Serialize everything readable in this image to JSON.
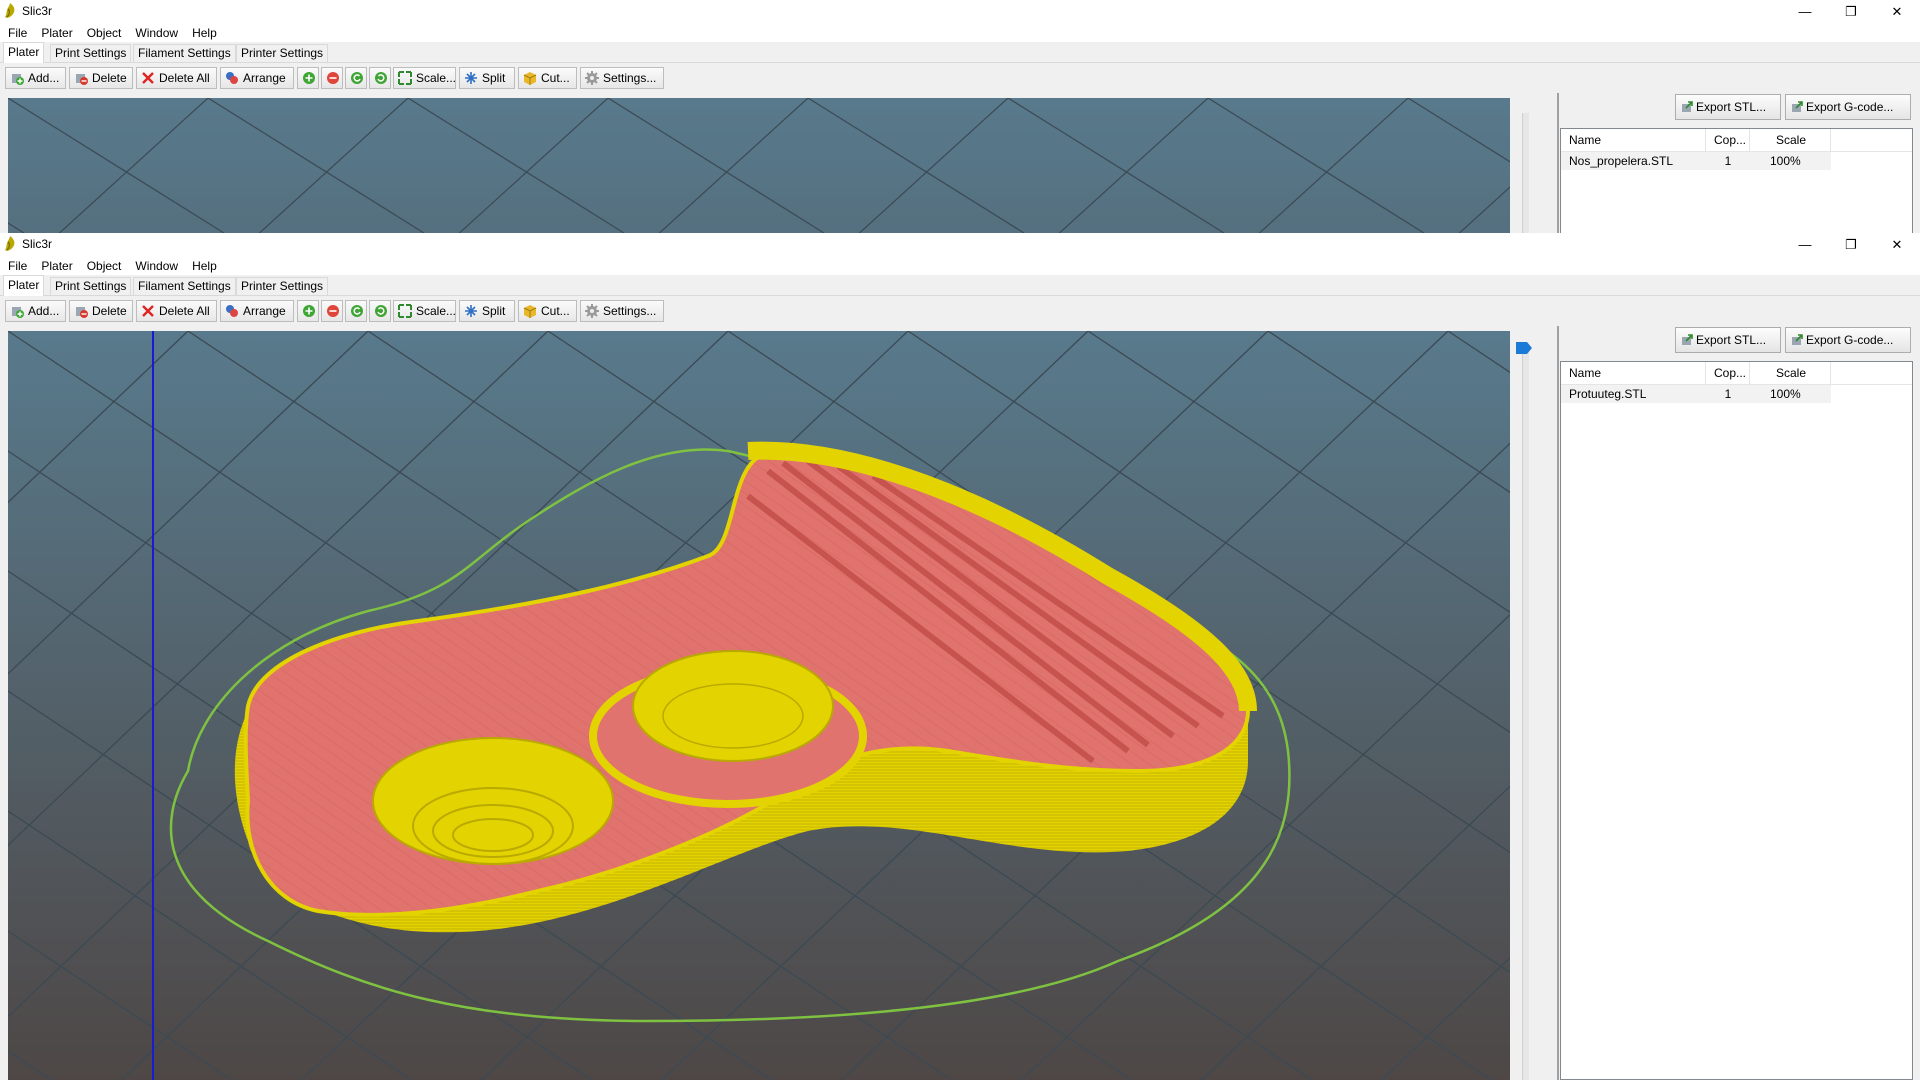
{
  "colors": {
    "canvas_top": "#587a8c",
    "canvas_bottom": "#4e4746",
    "grid": "#3b4a54",
    "model_wall": "#e3d300",
    "model_top": "#e0736e",
    "skirt": "#7fc241",
    "cut_line": "#1a1ad6",
    "slider_handle": "#1b7ad8"
  },
  "back_window": {
    "title": "Slic3r",
    "menu": [
      "File",
      "Plater",
      "Object",
      "Window",
      "Help"
    ],
    "tabs": [
      "Plater",
      "Print Settings",
      "Filament Settings",
      "Printer Settings"
    ],
    "toolbar": {
      "add": "Add...",
      "delete": "Delete",
      "delete_all": "Delete All",
      "arrange": "Arrange",
      "scale": "Scale...",
      "split": "Split",
      "cut": "Cut...",
      "settings": "Settings..."
    },
    "export_stl": "Export STL...",
    "export_gcode": "Export G-code...",
    "columns": [
      "Name",
      "Cop...",
      "Scale"
    ],
    "objects": [
      {
        "name": "Nos_propelera.STL",
        "copies": "1",
        "scale": "100%"
      }
    ]
  },
  "front_window": {
    "title": "Slic3r",
    "menu": [
      "File",
      "Plater",
      "Object",
      "Window",
      "Help"
    ],
    "tabs": [
      "Plater",
      "Print Settings",
      "Filament Settings",
      "Printer Settings"
    ],
    "toolbar": {
      "add": "Add...",
      "delete": "Delete",
      "delete_all": "Delete All",
      "arrange": "Arrange",
      "scale": "Scale...",
      "split": "Split",
      "cut": "Cut...",
      "settings": "Settings..."
    },
    "export_stl": "Export STL...",
    "export_gcode": "Export G-code...",
    "columns": [
      "Name",
      "Cop...",
      "Scale"
    ],
    "objects": [
      {
        "name": "Protuuteg.STL",
        "copies": "1",
        "scale": "100%"
      }
    ]
  }
}
